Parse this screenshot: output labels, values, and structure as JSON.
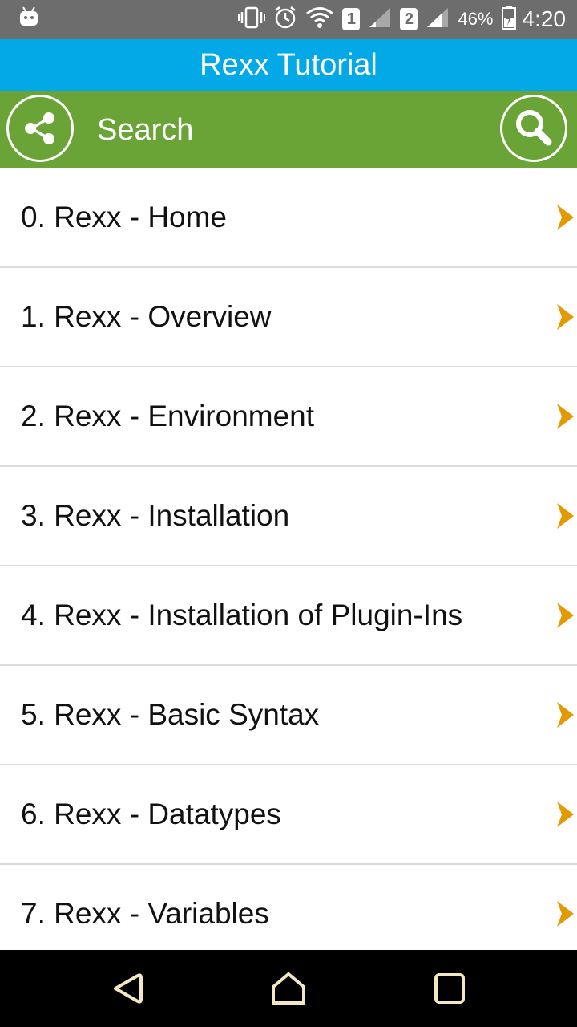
{
  "status_bar": {
    "sim1": "1",
    "sim2": "2",
    "battery": "46%",
    "time": "4:20",
    "icons": [
      "android-icon",
      "vibrate-icon",
      "alarm-icon",
      "wifi-icon",
      "signal-icon",
      "battery-icon"
    ]
  },
  "app": {
    "title": "Rexx Tutorial"
  },
  "search": {
    "label": "Search",
    "share_icon": "share-icon",
    "search_icon": "search-icon"
  },
  "colors": {
    "status_bar": "#6d6d6d",
    "title_bar": "#03a9e6",
    "search_bar": "#6aa336",
    "chevron": "#e29a00",
    "nav_bar": "#000000"
  },
  "list": {
    "items": [
      {
        "label": "0. Rexx - Home"
      },
      {
        "label": "1. Rexx - Overview"
      },
      {
        "label": "2. Rexx - Environment"
      },
      {
        "label": "3. Rexx - Installation"
      },
      {
        "label": "4. Rexx - Installation of Plugin-Ins"
      },
      {
        "label": "5. Rexx - Basic Syntax"
      },
      {
        "label": "6. Rexx - Datatypes"
      },
      {
        "label": "7. Rexx - Variables"
      }
    ]
  },
  "nav": {
    "buttons": [
      "back-icon",
      "home-icon",
      "recent-apps-icon"
    ]
  }
}
